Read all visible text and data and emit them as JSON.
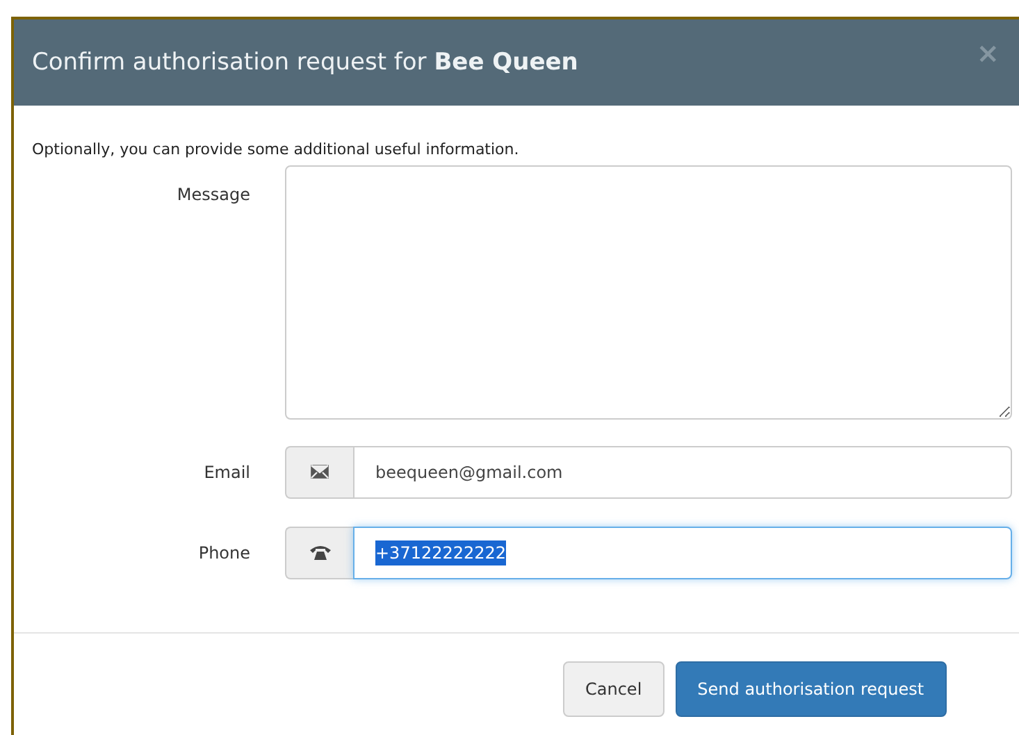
{
  "dialog": {
    "title": "Confirm authorisation request for **Bee Queen**",
    "close": "×"
  },
  "intro": "Optionally, you can provide some additional useful information.",
  "fields": [
    {
      "kind": "textarea",
      "label": "Message"
    },
    {
      "kind": "email",
      "label": "Email",
      "value": "beequeen@gmail.com",
      "focused": false,
      "text_selected": false
    },
    {
      "kind": "phone",
      "label": "Phone",
      "value": "+37122222222",
      "focused": true,
      "text_selected": true
    }
  ],
  "buttons": [
    {
      "label": "Cancel",
      "kind": "secondary"
    },
    {
      "label": "Send authorisation request",
      "kind": "primary"
    }
  ]
}
